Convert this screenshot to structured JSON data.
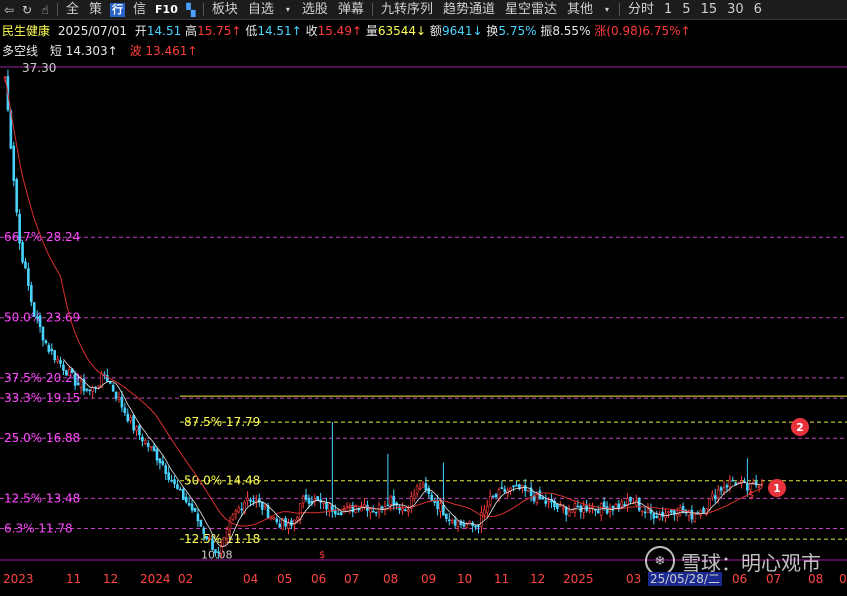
{
  "toolbar": {
    "icons": [
      "back-icon",
      "refresh-icon",
      "pointer-icon"
    ],
    "items_left": [
      "全",
      "策"
    ],
    "blue_label": "行",
    "item_xin": "信",
    "f10_label": "F10",
    "menu": [
      "板块",
      "自选",
      "选股",
      "弹幕",
      "九转序列",
      "趋势通道",
      "星空雷达",
      "其他"
    ],
    "right": [
      "分时",
      "1",
      "5",
      "15",
      "30",
      "6"
    ]
  },
  "info": {
    "name": "民生健康",
    "date": "2025/07/01",
    "open_label": "开",
    "open": "14.51",
    "high_label": "高",
    "high": "15.75↑",
    "low_label": "低",
    "low": "14.51↑",
    "close_label": "收",
    "close": "15.49↑",
    "vol_label": "量",
    "vol": "63544↓",
    "amt_label": "额",
    "amt": "9641↓",
    "turn_label": "换",
    "turn": "5.75%",
    "amp_label": "振",
    "amp": "8.55%",
    "chg_label": "涨",
    "chg": "(0.98)6.75%↑"
  },
  "indicator": {
    "name": "多空线",
    "short_label": "短",
    "short": "14.303↑",
    "wave_label": "波",
    "wave": "13.461↑"
  },
  "chart_data": {
    "type": "candlestick",
    "top_label": "37.30",
    "fib_levels": [
      {
        "label": "66.7% 28.24",
        "value": 28.24
      },
      {
        "label": "50.0% 23.69",
        "value": 23.69
      },
      {
        "label": "37.5% 20.29",
        "value": 20.29
      },
      {
        "label": "33.3% 19.15",
        "value": 19.15
      },
      {
        "label": "25.0% 16.88",
        "value": 16.88
      },
      {
        "label": "12.5% 13.48",
        "value": 13.48
      },
      {
        "label": "6.3% 11.78",
        "value": 11.78
      }
    ],
    "inner_fib": [
      {
        "label": "87.5% 17.79",
        "value": 17.79
      },
      {
        "label": "50.0% 14.48",
        "value": 14.48
      },
      {
        "label": "12.5% 11.18",
        "value": 11.18
      }
    ],
    "low_label": "10.08",
    "ylim": [
      10.0,
      37.8
    ],
    "x_labels": [
      "2023",
      "11",
      "12",
      "2024",
      "02",
      "04",
      "05",
      "06",
      "07",
      "08",
      "09",
      "10",
      "11",
      "12",
      "2025",
      "03",
      "06",
      "07",
      "08",
      "0"
    ],
    "date_badge": "25/05/28/二",
    "price_path": [
      37.3,
      28.0,
      24.0,
      22.0,
      21.0,
      20.0,
      19.5,
      20.5,
      19.0,
      17.5,
      16.5,
      15.5,
      14.0,
      13.0,
      11.5,
      10.2,
      12.5,
      13.6,
      13.0,
      12.2,
      11.8,
      13.6,
      13.2,
      12.9,
      12.8,
      13.2,
      12.8,
      13.5,
      12.8,
      14.2,
      13.4,
      12.5,
      12.0,
      11.9,
      13.4,
      13.9,
      14.0,
      13.6,
      13.2,
      12.8,
      12.9,
      13.0,
      12.9,
      13.1,
      13.3,
      12.6,
      12.6,
      12.9,
      12.5,
      13.0,
      14.0,
      14.5,
      14.0,
      14.5
    ]
  },
  "badges": [
    "1",
    "2"
  ],
  "watermark": {
    "icon": "snowball-icon",
    "text": "雪球：明心观市"
  }
}
